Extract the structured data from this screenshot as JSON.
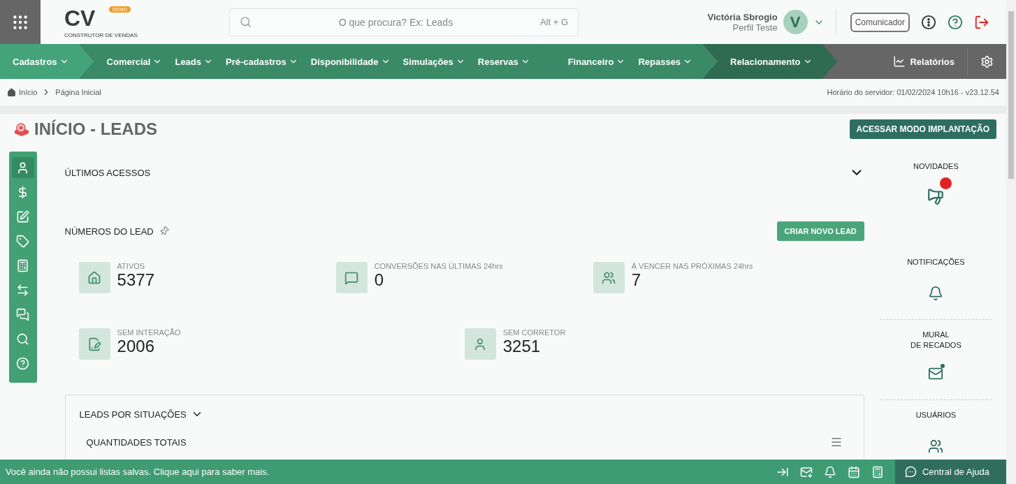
{
  "header": {
    "logo_text": "CV",
    "logo_badge": "DEMO",
    "logo_tagline": "CONSTRUTOR DE VENDAS",
    "search": {
      "placeholder": "O que procura? Ex: Leads",
      "shortcut": "Alt + G"
    },
    "user": {
      "name": "Victória Sbrogio",
      "profile": "Perfil Teste",
      "initial": "V"
    },
    "communicator_button": "Comunicador"
  },
  "nav": {
    "groups": [
      {
        "kind": "light",
        "items": [
          "Cadastros"
        ]
      },
      {
        "kind": "medium",
        "items": [
          "Comercial",
          "Leads",
          "Pré-cadastros",
          "Disponibilidade",
          "Simulações",
          "Reservas"
        ]
      },
      {
        "kind": "medium",
        "items": [
          "Financeiro",
          "Repasses"
        ]
      },
      {
        "kind": "dark",
        "items": [
          "Relacionamento"
        ]
      }
    ],
    "reports": "Relatórios"
  },
  "breadcrumb": [
    "Início",
    "Página Inicial"
  ],
  "server_time": "Horário do servidor: 01/02/2024 10h16 - v23.12.54",
  "page_title": "INÍCIO - LEADS",
  "implantation_button": "ACESSAR MODO IMPLANTAÇÃO",
  "sidebar": {
    "items": [
      {
        "selected": true
      },
      {
        "selected": false
      },
      {
        "selected": false
      },
      {
        "selected": false
      },
      {
        "selected": false
      },
      {
        "selected": false
      },
      {
        "selected": false
      },
      {
        "selected": false
      },
      {
        "selected": false
      }
    ]
  },
  "recent_access": {
    "title": "ÚLTIMOS ACESSOS",
    "expanded": false
  },
  "lead_numbers": {
    "title": "NÚMEROS DO LEAD",
    "create_button": "CRIAR NOVO LEAD",
    "rows": [
      [
        {
          "label": "ATIVOS",
          "value": "5377"
        },
        {
          "label": "CONVERSÕES NAS ÚLTIMAS 24hrs",
          "value": "0"
        },
        {
          "label": "À VENCER NAS PRÓXIMAS 24hrs",
          "value": "7"
        }
      ],
      [
        {
          "label": "SEM INTERAÇÃO",
          "value": "2006"
        },
        {
          "label": "SEM CORRETOR",
          "value": "3251"
        }
      ]
    ]
  },
  "situations": {
    "title": "LEADS POR SITUAÇÕES",
    "subtitle": "QUANTIDADES TOTAIS"
  },
  "right_panel": [
    {
      "kind": "news",
      "lines": [
        "NOVIDADES"
      ],
      "badge": true
    },
    {
      "kind": "notifications",
      "lines": [
        "NOTIFICAÇÕES"
      ],
      "badge": false
    },
    {
      "kind": "mural",
      "lines": [
        "MURAL",
        "DE RECADOS"
      ],
      "badge": true
    },
    {
      "kind": "users",
      "lines": [
        "USUÁRIOS"
      ],
      "badge": false
    }
  ],
  "footer": {
    "message": "Você ainda não possui listas salvas. Clique aqui para saber mais.",
    "help": "Central de Ajuda"
  }
}
